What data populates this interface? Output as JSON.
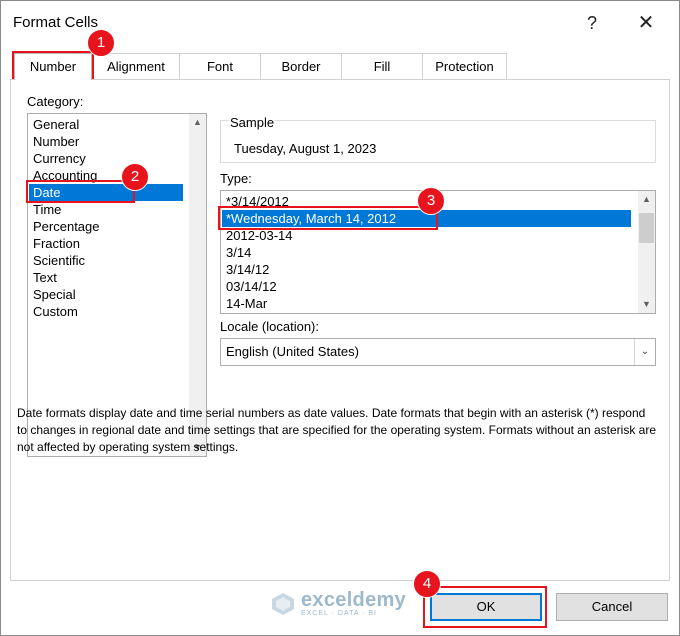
{
  "dialog": {
    "title": "Format Cells",
    "help_glyph": "?",
    "close_glyph": "✕"
  },
  "tabs": [
    {
      "label": "Number",
      "active": true
    },
    {
      "label": "Alignment",
      "active": false
    },
    {
      "label": "Font",
      "active": false
    },
    {
      "label": "Border",
      "active": false
    },
    {
      "label": "Fill",
      "active": false
    },
    {
      "label": "Protection",
      "active": false
    }
  ],
  "category": {
    "label": "Category:",
    "items": [
      "General",
      "Number",
      "Currency",
      "Accounting",
      "Date",
      "Time",
      "Percentage",
      "Fraction",
      "Scientific",
      "Text",
      "Special",
      "Custom"
    ],
    "selected": "Date"
  },
  "sample": {
    "label": "Sample",
    "value": "Tuesday, August 1, 2023"
  },
  "type": {
    "label": "Type:",
    "items": [
      "*3/14/2012",
      "*Wednesday, March 14, 2012",
      "2012-03-14",
      "3/14",
      "3/14/12",
      "03/14/12",
      "14-Mar"
    ],
    "selected": "*Wednesday, March 14, 2012"
  },
  "locale": {
    "label": "Locale (location):",
    "value": "English (United States)"
  },
  "description": "Date formats display date and time serial numbers as date values.  Date formats that begin with an asterisk (*) respond to changes in regional date and time settings that are specified for the operating system. Formats without an asterisk are not affected by operating system settings.",
  "buttons": {
    "ok": "OK",
    "cancel": "Cancel"
  },
  "annotations": [
    "1",
    "2",
    "3",
    "4"
  ],
  "watermark": {
    "name": "exceldemy",
    "tagline": "EXCEL · DATA · BI"
  },
  "colors": {
    "selection": "#0078d7",
    "annotation": "#e8141d"
  },
  "icons": {
    "scroll_up": "▲",
    "scroll_down": "▼",
    "dropdown": "⌄"
  }
}
